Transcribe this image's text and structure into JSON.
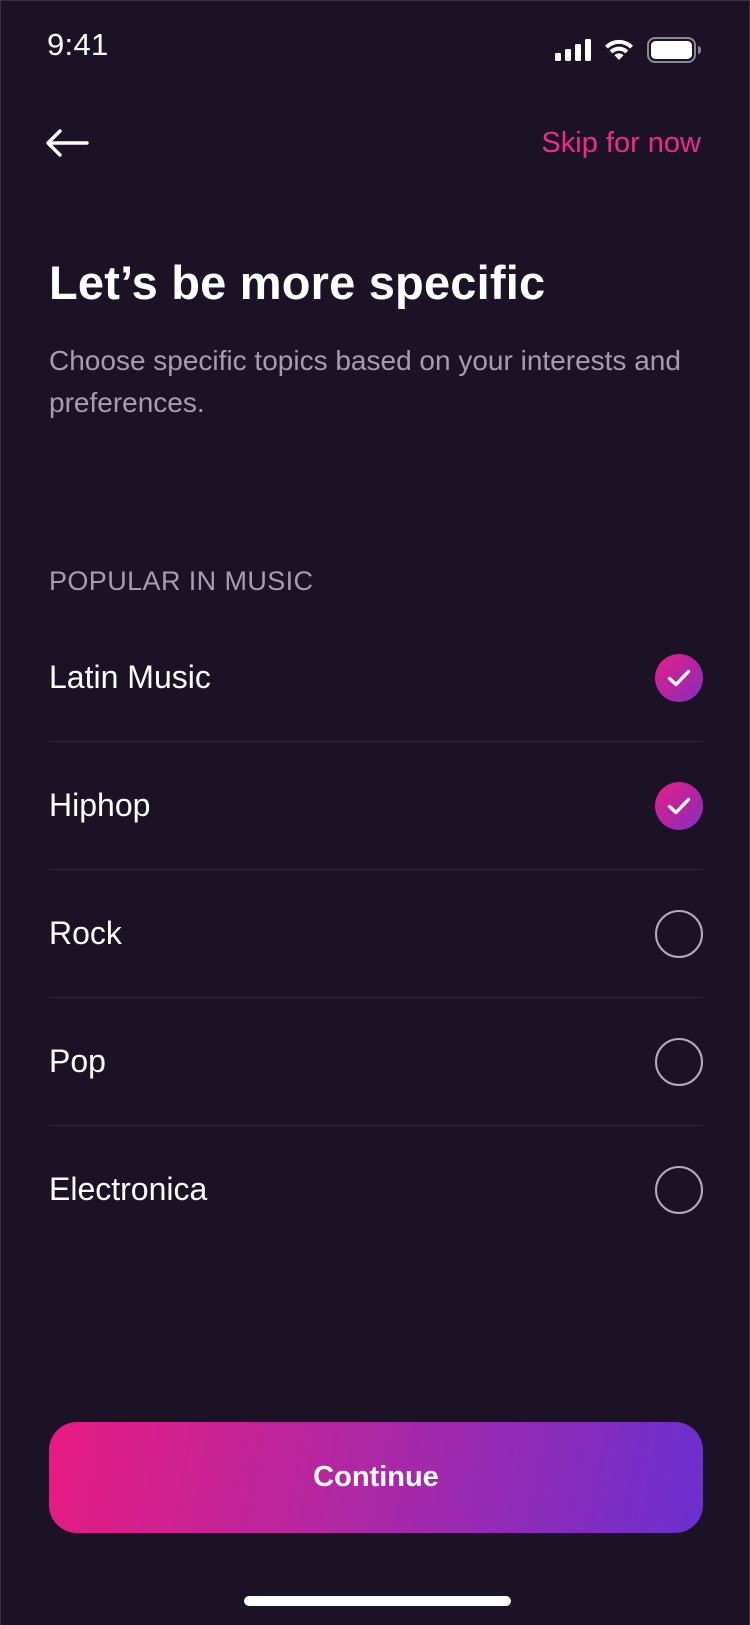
{
  "status_bar": {
    "time": "9:41",
    "icons": [
      "signal-icon",
      "wifi-icon",
      "battery-icon"
    ]
  },
  "nav": {
    "back_icon": "arrow-left-icon",
    "skip_label": "Skip for now"
  },
  "header": {
    "title": "Let’s be more specific",
    "subtitle": "Choose specific topics based on your interests and preferences."
  },
  "section": {
    "label": "POPULAR IN MUSIC"
  },
  "topics": [
    {
      "label": "Latin Music",
      "checked": true
    },
    {
      "label": "Hiphop",
      "checked": true
    },
    {
      "label": "Rock",
      "checked": false
    },
    {
      "label": "Pop",
      "checked": false
    },
    {
      "label": "Electronica",
      "checked": false
    }
  ],
  "footer": {
    "continue_label": "Continue"
  },
  "colors": {
    "background": "#1c1226",
    "accent_pink": "#ee2a8b",
    "accent_purple": "#6b2fcf",
    "muted_text": "#a69db2"
  }
}
